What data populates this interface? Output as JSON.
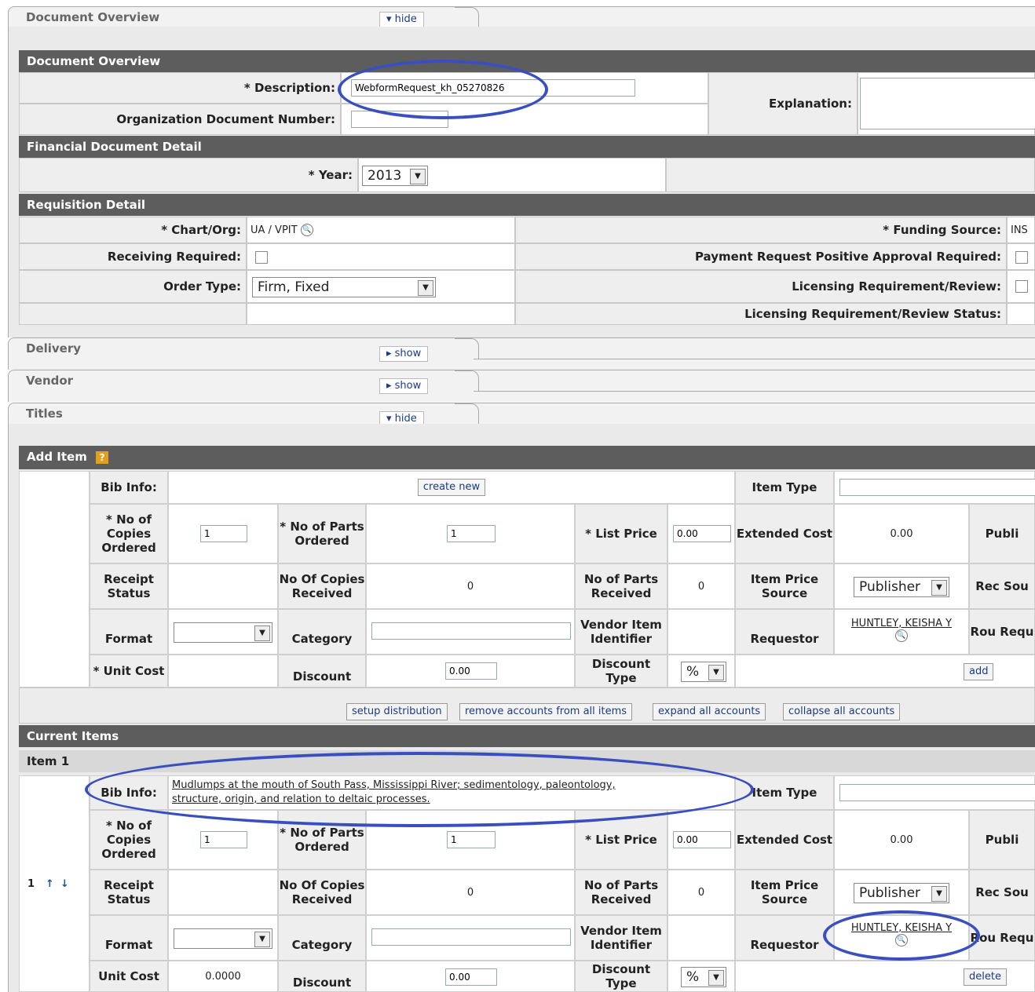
{
  "tabs": {
    "document_overview": {
      "title": "Document Overview",
      "toggle": "▾ hide"
    },
    "delivery": {
      "title": "Delivery",
      "toggle": "▸ show"
    },
    "vendor": {
      "title": "Vendor",
      "toggle": "▸ show"
    },
    "titles": {
      "title": "Titles",
      "toggle": "▾ hide"
    }
  },
  "overview": {
    "header": "Document Overview",
    "description_label": "* Description:",
    "description_value": "WebformRequest_kh_05270826",
    "explanation_label": "Explanation:",
    "org_doc_label": "Organization Document Number:",
    "financial_header": "Financial Document Detail",
    "year_label": "* Year:",
    "year_value": "2013"
  },
  "requisition": {
    "header": "Requisition Detail",
    "chart_label": "* Chart/Org:",
    "chart_value": "UA / VPIT",
    "funding_label": "* Funding Source:",
    "funding_value": "INS",
    "receiving_label": "Receiving Required:",
    "payment_label": "Payment Request Positive Approval Required:",
    "order_type_label": "Order Type:",
    "order_type_value": "Firm, Fixed",
    "licensing_label": "Licensing Requirement/Review:",
    "licensing_status_label": "Licensing Requirement/Review Status:"
  },
  "add_item": {
    "header": "Add Item",
    "help": "?",
    "create_new": "create new",
    "add": "add"
  },
  "labels": {
    "bib_info": "Bib Info:",
    "item_type": "Item Type",
    "no_copies_ordered": "* No of Copies Ordered",
    "no_parts_ordered": "* No of Parts Ordered",
    "list_price": "* List Price",
    "extended_cost": "Extended Cost",
    "publ": "Publi",
    "receipt_status": "Receipt Status",
    "no_copies_received": "No Of Copies Received",
    "no_parts_received": "No of Parts Received",
    "item_price_source": "Item Price Source",
    "rec_sou": "Rec Sou",
    "format": "Format",
    "category": "Category",
    "vendor_item_id": "Vendor Item Identifier",
    "requestor": "Requestor",
    "rou_requ": "Rou Requ",
    "unit_cost_req": "* Unit Cost",
    "unit_cost": "Unit Cost",
    "discount": "Discount",
    "discount_type": "Discount Type"
  },
  "values": {
    "copies": "1",
    "parts": "1",
    "list_price": "0.00",
    "extended_cost": "0.00",
    "received_copies": "0",
    "received_parts": "0",
    "price_source": "Publisher",
    "requestor": "HUNTLEY, KEISHA Y",
    "discount": "0.00",
    "discount_type": "%",
    "unit_cost": "0.0000"
  },
  "actions": {
    "setup_distribution": "setup distribution",
    "remove_accounts": "remove accounts from all items",
    "expand_accounts": "expand all accounts",
    "collapse_accounts": "collapse all accounts"
  },
  "current_items": {
    "header": "Current Items",
    "item_header": "Item 1",
    "row_number": "1",
    "bib_line1": "Mudlumps at the mouth of South Pass, Mississippi River; sedimentology, paleontology,",
    "bib_line2": "structure, origin, and relation to deltaic processes.",
    "delete": "delete"
  },
  "colors": {
    "header_bg": "#5d5d5d",
    "panel_bg": "#eaeaea",
    "annotation": "#3a4fbf"
  }
}
